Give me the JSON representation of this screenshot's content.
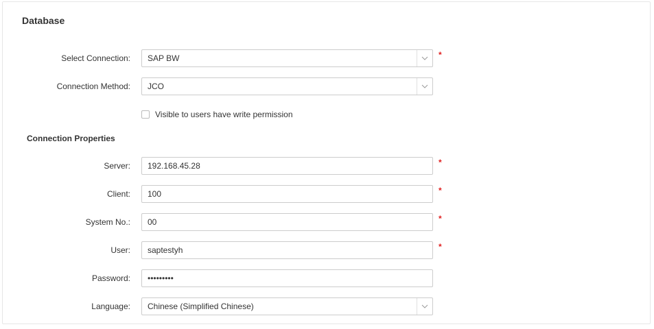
{
  "section": {
    "title": "Database"
  },
  "select_connection": {
    "label": "Select Connection:",
    "value": "SAP BW",
    "required": "*"
  },
  "connection_method": {
    "label": "Connection Method:",
    "value": "JCO"
  },
  "visibility": {
    "label": "Visible to users have write permission"
  },
  "properties": {
    "title": "Connection Properties",
    "server": {
      "label": "Server:",
      "value": "192.168.45.28",
      "required": "*"
    },
    "client": {
      "label": "Client:",
      "value": "100",
      "required": "*"
    },
    "system_no": {
      "label": "System No.:",
      "value": "00",
      "required": "*"
    },
    "user": {
      "label": "User:",
      "value": "saptestyh",
      "required": "*"
    },
    "password": {
      "label": "Password:",
      "value": "•••••••••"
    },
    "language": {
      "label": "Language:",
      "value": "Chinese (Simplified Chinese)"
    }
  },
  "icons": {
    "dropdown": "chevron-down-icon",
    "required_marker": "asterisk"
  },
  "colors": {
    "required": "#e02020",
    "border": "#cccccc"
  }
}
